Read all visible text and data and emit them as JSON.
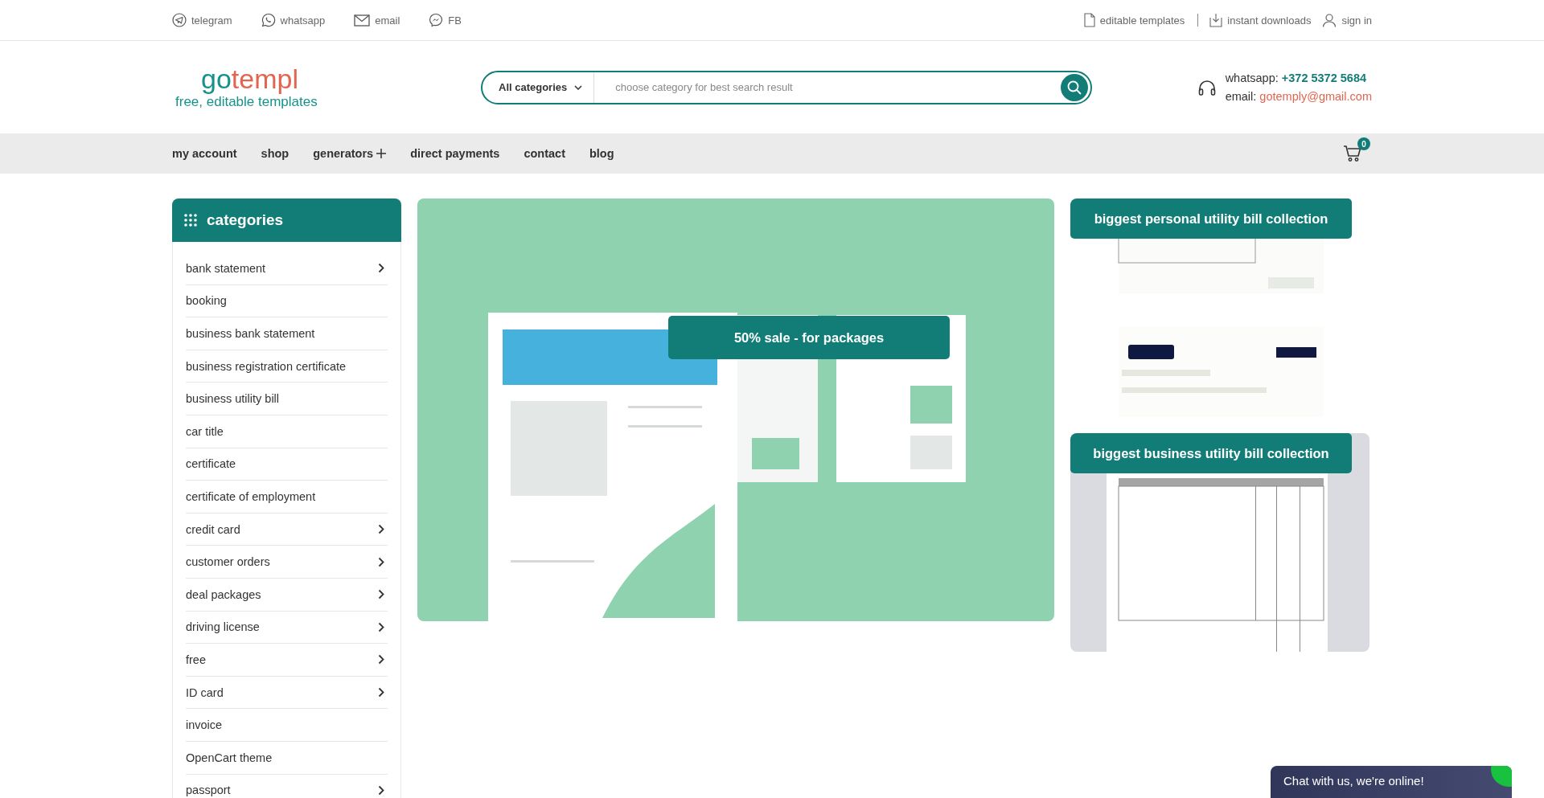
{
  "top_bar": {
    "social_links": [
      {
        "kind": "telegram",
        "label": "telegram"
      },
      {
        "kind": "whatsapp",
        "label": "whatsapp"
      },
      {
        "kind": "email",
        "label": "email"
      },
      {
        "kind": "messenger",
        "label": "FB"
      }
    ],
    "info_links": [
      {
        "kind": "document",
        "label": "editable templates"
      },
      {
        "kind": "download",
        "label": "instant downloads"
      },
      {
        "kind": "user",
        "label": "sign in"
      }
    ]
  },
  "header": {
    "logo": {
      "parts": [
        {
          "text": "go",
          "color": "#16928a"
        },
        {
          "text": "templ",
          "color": "#e2654f"
        }
      ],
      "tagline": "free, editable templates"
    },
    "search": {
      "category": "All categories",
      "placeholder": "choose category for best search result"
    },
    "contact": [
      {
        "label": "whatsapp:",
        "value": "+372 5372 5684",
        "color": "#127d77"
      },
      {
        "label": "email:",
        "value": "gotemply@gmail.com",
        "color": "#e2654f"
      }
    ]
  },
  "nav": {
    "items": [
      {
        "label": "my account",
        "has_plus": false
      },
      {
        "label": "shop",
        "has_plus": false
      },
      {
        "label": "generators",
        "has_plus": true
      },
      {
        "label": "direct payments",
        "has_plus": false
      },
      {
        "label": "contact",
        "has_plus": false
      },
      {
        "label": "blog",
        "has_plus": false
      }
    ],
    "cart_count": "0"
  },
  "sidebar": {
    "title": "categories",
    "items": [
      {
        "label": "bank statement",
        "has_submenu": true
      },
      {
        "label": "booking",
        "has_submenu": false
      },
      {
        "label": "business bank statement",
        "has_submenu": false
      },
      {
        "label": "business registration certificate",
        "has_submenu": false
      },
      {
        "label": "business utility bill",
        "has_submenu": false
      },
      {
        "label": "car title",
        "has_submenu": false
      },
      {
        "label": "certificate",
        "has_submenu": false
      },
      {
        "label": "certificate of employment",
        "has_submenu": false
      },
      {
        "label": "credit card",
        "has_submenu": true
      },
      {
        "label": "customer orders",
        "has_submenu": true
      },
      {
        "label": "deal packages",
        "has_submenu": true
      },
      {
        "label": "driving license",
        "has_submenu": true
      },
      {
        "label": "free",
        "has_submenu": true
      },
      {
        "label": "ID card",
        "has_submenu": true
      },
      {
        "label": "invoice",
        "has_submenu": false
      },
      {
        "label": "OpenCart theme",
        "has_submenu": false
      },
      {
        "label": "passport",
        "has_submenu": true
      }
    ]
  },
  "banner": {
    "kind": "picture",
    "caption": "50% sale - for packages"
  },
  "promo_cards": [
    {
      "kind": "picture",
      "caption": "biggest personal utility bill collection"
    },
    {
      "kind": "picture",
      "caption": "biggest business utility bill collection"
    }
  ],
  "chat_widget": {
    "label": "Chat with us, we're online!",
    "online": true
  }
}
